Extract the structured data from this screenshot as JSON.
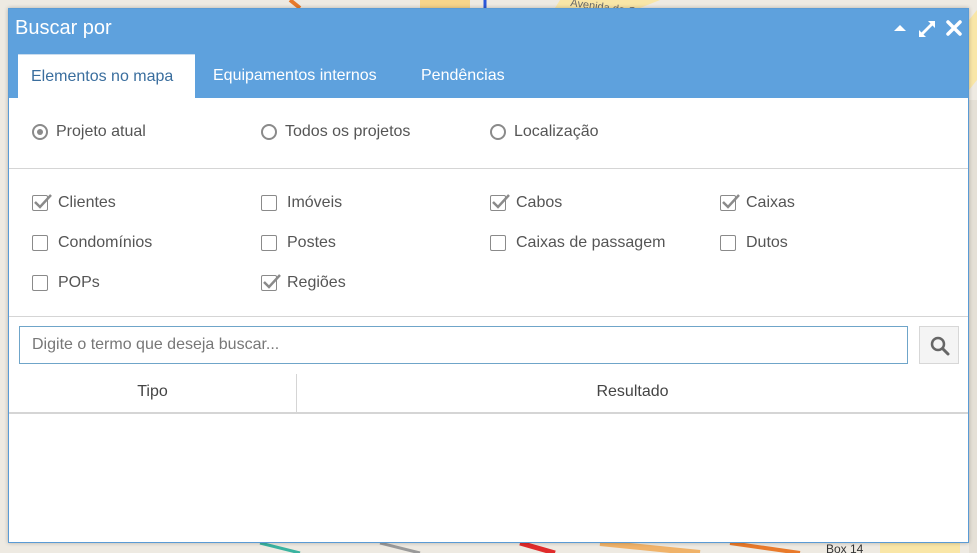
{
  "dialog": {
    "title": "Buscar por",
    "controls": {
      "minimize": "caret-up-icon",
      "maximize": "expand-icon",
      "close": "close-icon"
    }
  },
  "tabs": [
    {
      "label": "Elementos no mapa",
      "active": true
    },
    {
      "label": "Equipamentos internos",
      "active": false
    },
    {
      "label": "Pendências",
      "active": false
    }
  ],
  "scope_options": [
    {
      "label": "Projeto atual",
      "selected": true
    },
    {
      "label": "Todos os projetos",
      "selected": false
    },
    {
      "label": "Localização",
      "selected": false
    }
  ],
  "element_filters": [
    {
      "label": "Clientes",
      "checked": true
    },
    {
      "label": "Imóveis",
      "checked": false
    },
    {
      "label": "Cabos",
      "checked": true
    },
    {
      "label": "Caixas",
      "checked": true
    },
    {
      "label": "Condomínios",
      "checked": false
    },
    {
      "label": "Postes",
      "checked": false
    },
    {
      "label": "Caixas de passagem",
      "checked": false
    },
    {
      "label": "Dutos",
      "checked": false
    },
    {
      "label": "POPs",
      "checked": false
    },
    {
      "label": "Regiões",
      "checked": true
    }
  ],
  "search": {
    "placeholder": "Digite o termo que deseja buscar...",
    "value": "",
    "button_icon": "search-icon"
  },
  "results_table": {
    "columns": [
      "Tipo",
      "Resultado"
    ],
    "rows": []
  },
  "map_labels": {
    "street": "Avenida da C",
    "box": "Box 14"
  },
  "colors": {
    "header": "#5ea1dd",
    "active_tab_text": "#3a6e9e",
    "input_border": "#6fa5c9"
  }
}
